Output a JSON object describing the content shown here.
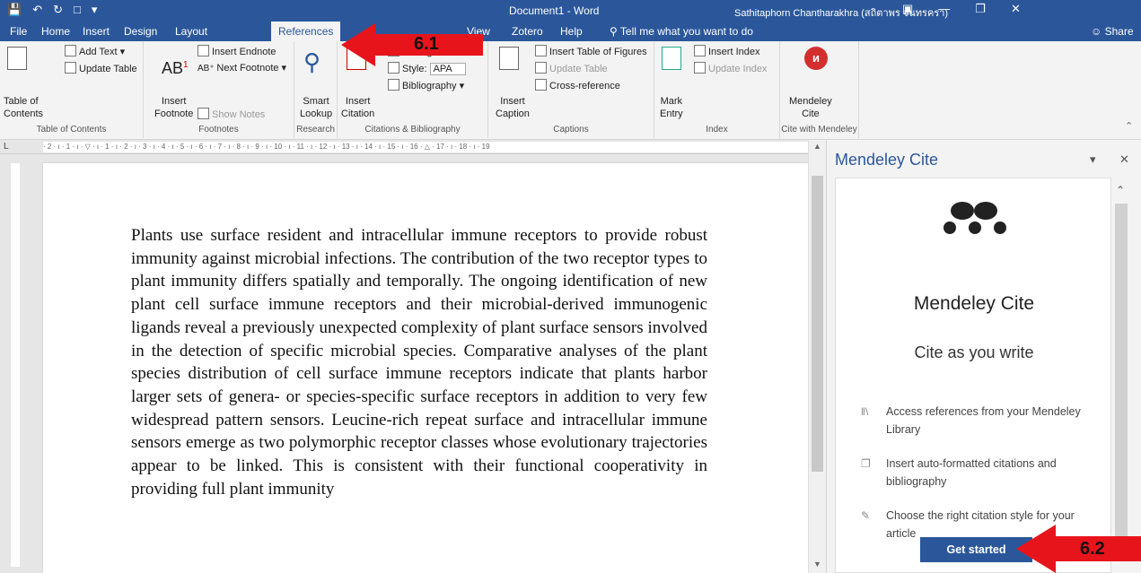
{
  "titlebar": {
    "document": "Document1  -  Word",
    "user": "Sathitaphorn Chantharakhra (สถิตาพร จันทรครา)"
  },
  "tabs": [
    "File",
    "Home",
    "Insert",
    "Design",
    "Layout",
    "References",
    "View",
    "Zotero",
    "Help"
  ],
  "tellme": "Tell me what you want to do",
  "share": "Share",
  "ribbon": {
    "toc": {
      "big": "Table of\nContents",
      "add_text": "Add Text",
      "update": "Update Table",
      "group": "Table of Contents"
    },
    "footnotes": {
      "insert_footnote": "Insert\nFootnote",
      "insert_endnote": "Insert Endnote",
      "next_footnote": "Next Footnote",
      "show_notes": "Show Notes",
      "group": "Footnotes"
    },
    "research": {
      "smart_lookup": "Smart\nLookup",
      "group": "Research"
    },
    "citations": {
      "insert_citation": "Insert\nCitation",
      "manage_sources": "Manage Sources",
      "style_label": "Style:",
      "style_value": "APA",
      "bibliography": "Bibliography",
      "group": "Citations & Bibliography"
    },
    "captions": {
      "insert_caption": "Insert\nCaption",
      "insert_tof": "Insert Table of Figures",
      "update_table": "Update Table",
      "cross_ref": "Cross-reference",
      "group": "Captions"
    },
    "index": {
      "mark_entry": "Mark\nEntry",
      "insert_index": "Insert Index",
      "update_index": "Update Index",
      "group": "Index"
    },
    "mendeley": {
      "label": "Mendeley\nCite",
      "group": "Cite with Mendeley"
    }
  },
  "document": {
    "paragraph": "Plants use surface resident and intracellular immune receptors to provide robust immunity against microbial infections. The contribution of the two receptor types to plant immunity differs spatially and temporally. The ongoing identification of new plant cell surface immune receptors and their microbial-derived immunogenic ligands reveal a previously unexpected complexity of plant surface sensors involved in the detection of specific microbial species. Comparative analyses of the plant species distribution of cell surface immune receptors indicate that plants harbor larger sets of genera- or species-specific surface receptors in addition to very few widespread pattern sensors. Leucine-rich repeat surface and intracellular immune sensors emerge as two polymorphic receptor classes whose evolutionary trajectories appear to be linked. This is consistent with their functional cooperativity in providing full plant immunity"
  },
  "ruler_text": "· 2 · ı · 1 · ı · ▽ · ı · 1 · ı · 2 · ı · 3 · ı · 4 · ı · 5 · ı · 6 · ı · 7 · ı · 8 · ı · 9 · ı · 10 · ı · 11 · ı · 12 · ı · 13 · ı · 14 · ı · 15 · ı · 16 · △ · 17 · ı · 18 · ı · 19",
  "pane": {
    "title": "Mendeley Cite",
    "heading": "Mendeley Cite",
    "subheading": "Cite as you write",
    "features": [
      {
        "icon": "library-icon",
        "text": "Access references from your Mendeley Library"
      },
      {
        "icon": "citation-icon",
        "text": "Insert auto-formatted citations and bibliography"
      },
      {
        "icon": "style-icon",
        "text": "Choose the right citation style for your article"
      }
    ],
    "button": "Get started"
  },
  "annotations": {
    "step1": "6.1",
    "step2": "6.2"
  },
  "colors": {
    "word_blue": "#2b579a",
    "arrow_red": "#e8141c",
    "mendeley_red": "#d32f2f"
  }
}
